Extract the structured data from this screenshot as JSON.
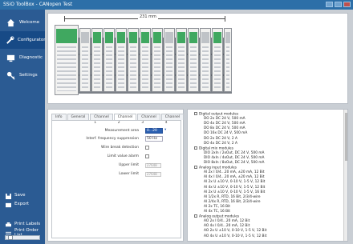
{
  "window": {
    "title": "SSiO ToolBox - CANopen Test"
  },
  "sidebar": {
    "items": [
      {
        "label": "Welcome",
        "icon": "home-icon",
        "active": false
      },
      {
        "label": "Configurator",
        "icon": "tools-icon",
        "active": true
      },
      {
        "label": "Diagnostic",
        "icon": "monitor-icon",
        "active": false
      },
      {
        "label": "Settings",
        "icon": "key-icon",
        "active": false
      }
    ],
    "bottom": [
      {
        "label": "Save",
        "icon": "save-icon"
      },
      {
        "label": "Export",
        "icon": "export-icon"
      },
      {
        "label": "Print Labels",
        "icon": "print-icon"
      },
      {
        "label": "Print Order List",
        "icon": "list-icon"
      }
    ]
  },
  "canvas": {
    "dimension": "231 mm"
  },
  "tabs": {
    "items": [
      "Info",
      "General",
      "Channel 1",
      "Channel 2",
      "Channel 3",
      "Channel 4"
    ],
    "active": 3
  },
  "form": {
    "measurement_label": "Measurement area",
    "measurement_value": "0...20",
    "interference_label": "Interf. frequency suppression",
    "interference_value": "50 Hz",
    "wire_break_label": "Wire break detection",
    "limit_alarm_label": "Limit value alarm",
    "upper_label": "Upper limit",
    "upper_value": "27648",
    "lower_label": "Lower limit",
    "lower_value": "27648"
  },
  "tree": {
    "lines": [
      {
        "text": "Digital output modules",
        "cat": true
      },
      {
        "text": "DO 2x DC 24 V, 500 mA",
        "cat": false
      },
      {
        "text": "DO 4x DC 24 V, 500 mA",
        "cat": false
      },
      {
        "text": "DO 8x DC 24 V, 500 mA",
        "cat": false
      },
      {
        "text": "DO 16x DC 24 V, 500 mA",
        "cat": false
      },
      {
        "text": "DO 2x DC 24 V, 2 A",
        "cat": false
      },
      {
        "text": "DO 4x DC 24 V, 2 A",
        "cat": false
      },
      {
        "text": "Digital mix modules",
        "cat": true
      },
      {
        "text": "DIO 2xIn / 2xOut, DC 24 V, 500 mA",
        "cat": false
      },
      {
        "text": "DIO 4xIn / 4xOut, DC 24 V, 500 mA",
        "cat": false
      },
      {
        "text": "DIO 8xIn / 8xOut, DC 24 V, 500 mA",
        "cat": false
      },
      {
        "text": "Analog input modules",
        "cat": true
      },
      {
        "text": "AI 2x I 0/4...20 mA, ±20 mA, 12 Bit",
        "cat": false
      },
      {
        "text": "AI 4x I 0/4...20 mA, ±20 mA, 12 Bit",
        "cat": false
      },
      {
        "text": "AI 2x U ±10 V, 0-10 V, 1-5 V, 12 Bit",
        "cat": false
      },
      {
        "text": "AI 4x U ±10 V, 0-10 V, 1-5 V, 12 Bit",
        "cat": false
      },
      {
        "text": "AI 2x U ±10 V, 0-10 V, 1-5 V, 16 Bit",
        "cat": false
      },
      {
        "text": "AI 1/2x R, RTD, 16 Bit, 2/3/4-wire",
        "cat": false
      },
      {
        "text": "AI 2/4x R, RTD, 16 Bit, 2/3/4-wire",
        "cat": false
      },
      {
        "text": "AI 2x TC, 16 Bit",
        "cat": false
      },
      {
        "text": "AI 4x TC, 16 Bit",
        "cat": false
      },
      {
        "text": "Analog output modules",
        "cat": true
      },
      {
        "text": "AO 2x I 0/4...20 mA, 12 Bit",
        "cat": false
      },
      {
        "text": "AO 4x I 0/4...20 mA, 12 Bit",
        "cat": false
      },
      {
        "text": "AO 2x U ±10 V, 0-10 V, 1-5 V, 12 Bit",
        "cat": false
      },
      {
        "text": "AO 4x U ±10 V, 0-10 V, 1-5 V, 12 Bit",
        "cat": false
      }
    ]
  },
  "colors": {
    "sidebar": "#2b5b93",
    "accent": "#2a5fb0",
    "titlebar": "#2d6fa8",
    "module_green": "#40a860"
  }
}
